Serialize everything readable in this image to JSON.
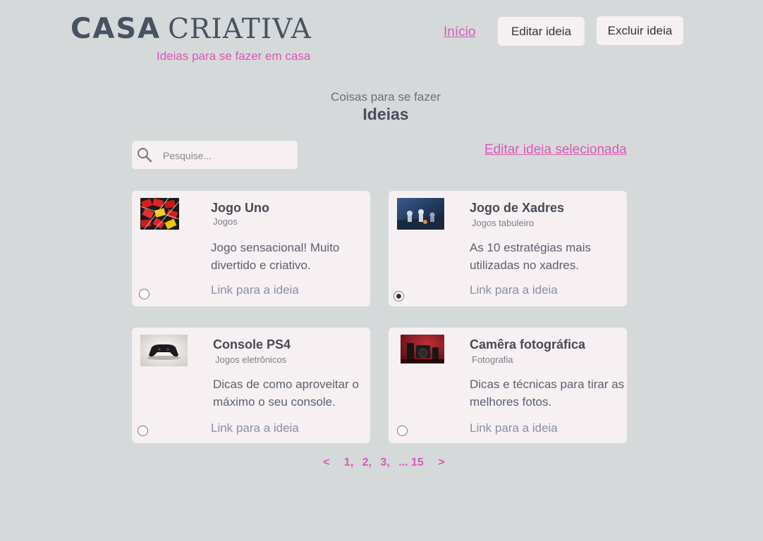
{
  "header": {
    "logo_casa": "CASA",
    "logo_criativa": "CRIATIVA",
    "logo_subtitle": "Ideias para se fazer em casa",
    "nav_home": "Início",
    "edit_button": "Editar ideia",
    "delete_button": "Excluir ideia"
  },
  "section": {
    "kicker": "Coisas para se fazer",
    "title": "Ideias"
  },
  "search": {
    "placeholder": "Pesquise..."
  },
  "edit_selected_link": "Editar ideia selecionada",
  "cards": [
    {
      "title": "Jogo Uno",
      "category": "Jogos",
      "description": "Jogo sensacional! Muito divertido e criativo.",
      "link": "Link para a ideia",
      "selected": false
    },
    {
      "title": "Jogo de Xadres",
      "category": "Jogos tabuleiro",
      "description": "As 10 estratégias mais utilizadas no xadres.",
      "link": "Link para a ideia",
      "selected": true
    },
    {
      "title": "Console PS4",
      "category": "Jogos eletrônicos",
      "description": "Dicas de como aproveitar o máximo o seu console.",
      "link": "Link para a ideia",
      "selected": false
    },
    {
      "title": "Camêra fotográfica",
      "category": "Fotografia",
      "description": "Dicas e técnicas para tirar as melhores fotos.",
      "link": "Link para a ideia",
      "selected": false
    }
  ],
  "pagination": {
    "prev": "<",
    "pages": [
      "1,",
      "2,",
      "3,",
      "... 15"
    ],
    "next": ">"
  },
  "colors": {
    "background": "#d5d9da",
    "card": "#f6f0f2",
    "accent": "#d958b8",
    "text": "#4a4f5c"
  }
}
